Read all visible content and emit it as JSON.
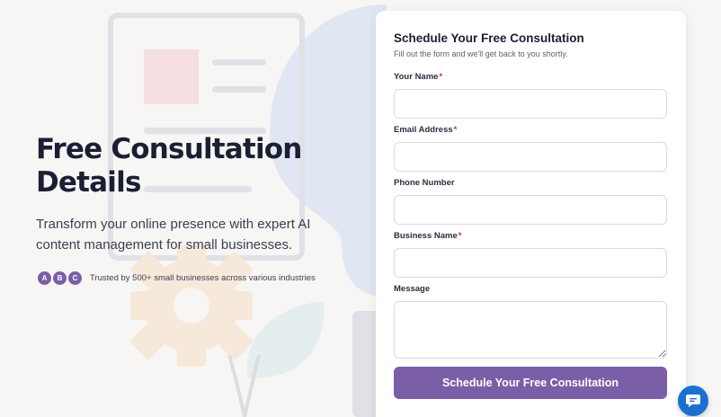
{
  "hero": {
    "title": "Free Consultation Details",
    "subtitle": "Transform your online presence with expert AI content management for small businesses.",
    "avatars": [
      "A",
      "B",
      "C"
    ],
    "trust_text": "Trusted by 500+ small businesses across various industries"
  },
  "form": {
    "title": "Schedule Your Free Consultation",
    "intro": "Fill out the form and we'll get back to you shortly.",
    "required_marker": "*",
    "fields": [
      {
        "label": "Your Name",
        "required": true,
        "value": "",
        "placeholder": ""
      },
      {
        "label": "Email Address",
        "required": true,
        "value": "",
        "placeholder": ""
      },
      {
        "label": "Phone Number",
        "required": false,
        "value": "",
        "placeholder": ""
      },
      {
        "label": "Business Name",
        "required": true,
        "value": "",
        "placeholder": ""
      },
      {
        "label": "Message",
        "required": false,
        "value": "",
        "placeholder": ""
      }
    ],
    "submit_label": "Schedule Your Free Consultation"
  },
  "colors": {
    "accent": "#7b5ea8",
    "required": "#d9303a",
    "chat": "#1a6fd1"
  },
  "icons": {
    "chat": "chat-bubble-icon"
  }
}
